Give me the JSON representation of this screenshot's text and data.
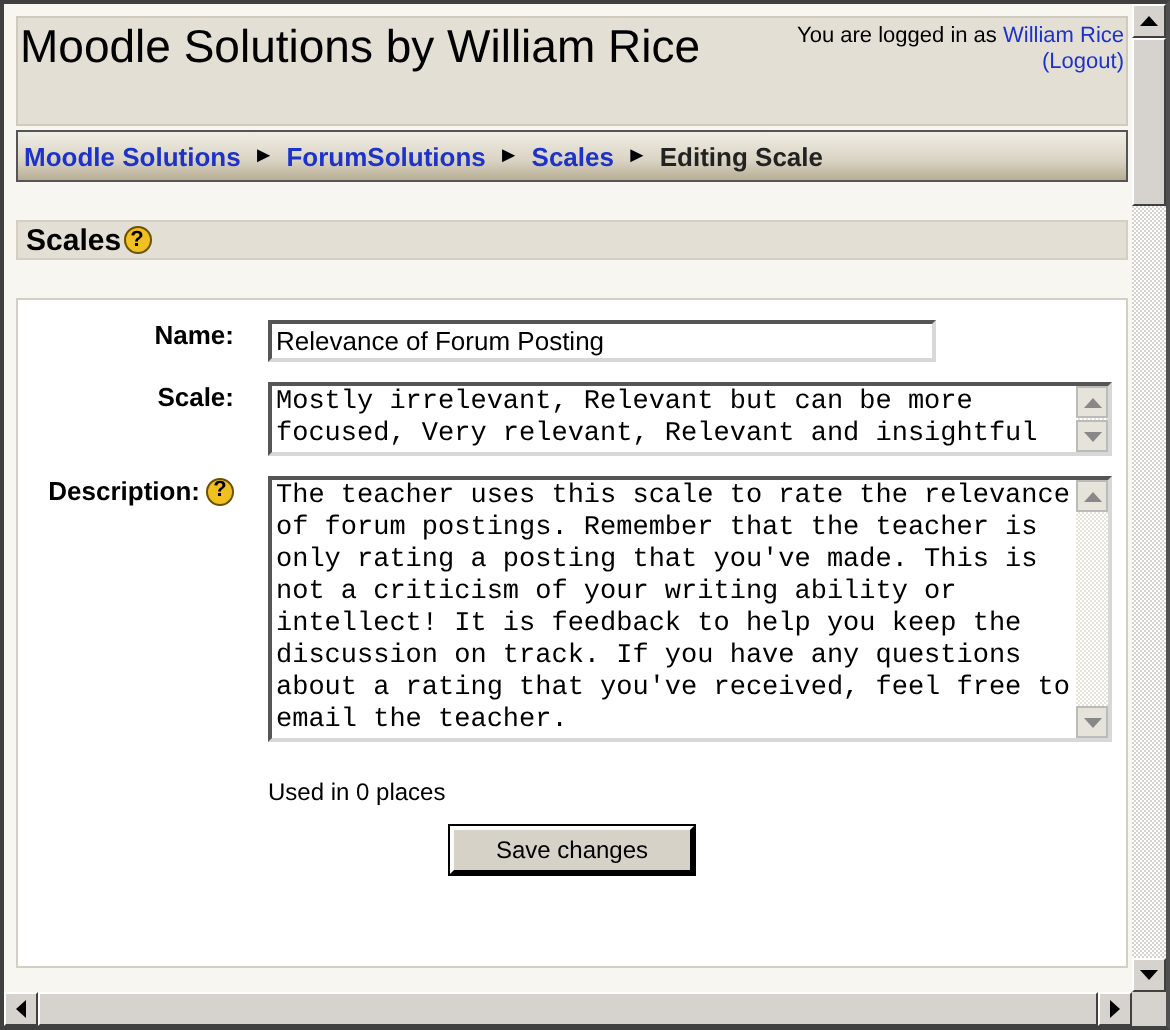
{
  "header": {
    "site_title": "Moodle Solutions by William Rice",
    "login_text": "You are logged in as",
    "user_link": "William Rice",
    "logout_link": "(Logout)"
  },
  "breadcrumb": {
    "separator": "►",
    "items": [
      {
        "label": "Moodle Solutions",
        "link": true
      },
      {
        "label": "ForumSolutions",
        "link": true
      },
      {
        "label": "Scales",
        "link": true
      },
      {
        "label": "Editing Scale",
        "link": false
      }
    ]
  },
  "section": {
    "title": "Scales",
    "help_glyph": "?"
  },
  "form": {
    "fields": [
      {
        "kind": "input",
        "label": "Name:",
        "value": "Relevance of Forum Posting"
      },
      {
        "kind": "textarea",
        "label": "Scale:",
        "value": "Mostly irrelevant, Relevant but can be more focused, Very relevant, Relevant and insightful"
      },
      {
        "kind": "textarea",
        "label": "Description:",
        "help_glyph": "?",
        "value": "The teacher uses this scale to rate the relevance of forum postings. Remember that the teacher is only rating a posting that you've made. This is not a criticism of your writing ability or intellect! It is feedback to help you keep the discussion on track. If you have any questions about a rating that you've received, feel free to email the teacher."
      }
    ],
    "usage": "Used in 0 places",
    "submit": "Save changes"
  }
}
